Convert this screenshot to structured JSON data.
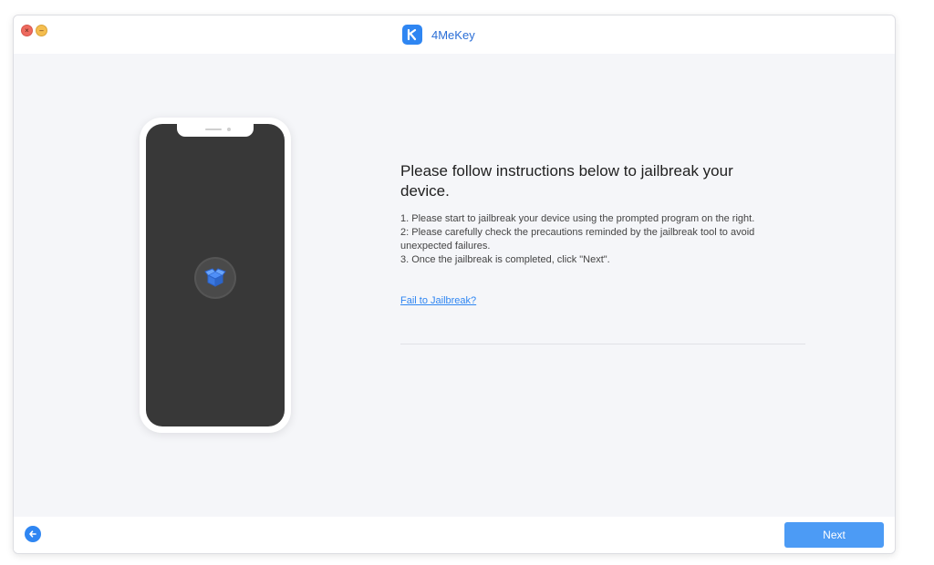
{
  "window": {
    "title": "4MeKey",
    "controls": [
      "close",
      "minimize"
    ]
  },
  "icons": {
    "logo": "4mekey-logo-icon",
    "device_center": "open-box-icon",
    "back": "arrow-left-icon"
  },
  "main": {
    "heading": "Please follow instructions below to jailbreak your device.",
    "steps": [
      "1. Please start to jailbreak your device using the prompted program on the right.",
      "2: Please carefully check the precautions reminded by the jailbreak tool to avoid unexpected failures.",
      "3. Once the jailbreak is completed, click \"Next\"."
    ],
    "fail_link": "Fail to Jailbreak?"
  },
  "footer": {
    "next_label": "Next"
  },
  "colors": {
    "accent": "#2f86f2",
    "next_button": "#4c9bf5",
    "background": "#f5f6f9",
    "phone_screen": "#383838"
  }
}
